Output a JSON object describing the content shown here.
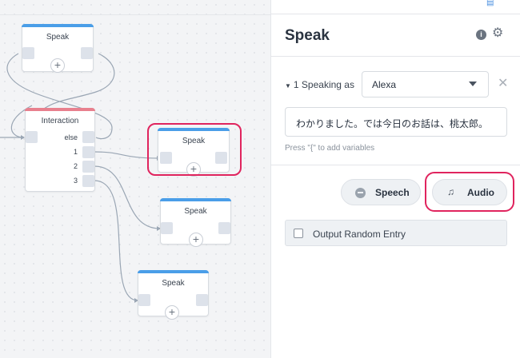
{
  "canvas": {
    "blocks": {
      "speak_top": {
        "title": "Speak"
      },
      "interaction": {
        "title": "Interaction",
        "branches": [
          "else",
          "1",
          "2",
          "3"
        ]
      },
      "speak_selected": {
        "title": "Speak"
      },
      "speak_mid": {
        "title": "Speak"
      },
      "speak_bottom": {
        "title": "Speak"
      }
    },
    "add_symbol": "+"
  },
  "panel": {
    "title": "Speak",
    "info_icon": "i",
    "speaking_as_label": "1 Speaking as",
    "voice": "Alexa",
    "speech_text": "わかりました。では今日のお話は、桃太郎。",
    "hint": "Press \"{\" to add variables",
    "speech_button": "Speech",
    "audio_button": "Audio",
    "random_entry_label": "Output Random Entry"
  },
  "colors": {
    "speak_accent": "#4a9ee8",
    "interaction_accent": "#e8808e",
    "highlight": "#e0245e"
  },
  "icons": [
    "document-icon",
    "info-icon",
    "gear-icon",
    "remove-icon",
    "speech-bubble-icon",
    "music-note-icon",
    "add-icon"
  ]
}
